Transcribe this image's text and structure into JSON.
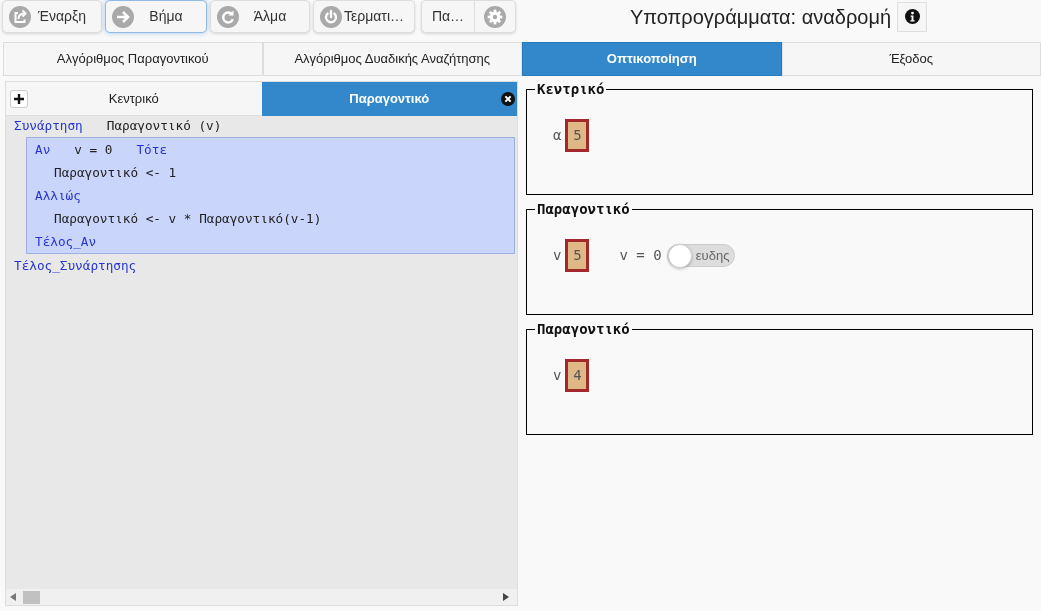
{
  "toolbar": {
    "buttons": [
      {
        "label": "Έναρξη",
        "focused": false
      },
      {
        "label": "Βήμα",
        "focused": true
      },
      {
        "label": "Άλμα",
        "focused": false
      },
      {
        "label": "Τερματι…",
        "focused": false
      }
    ],
    "menu_button": {
      "label": "Πα…"
    }
  },
  "title": "Υποπρογράμματα: αναδρομή",
  "tabs": [
    {
      "label": "Αλγόριθμος Παραγοντικού",
      "selected": false
    },
    {
      "label": "Αλγόριθμος Δυαδικής Αναζήτησης",
      "selected": false
    },
    {
      "label": "Οπτικοποίηση",
      "selected": true
    },
    {
      "label": "Έξοδος",
      "selected": false
    }
  ],
  "editor": {
    "tabs": [
      {
        "label": "Κεντρικό",
        "selected": false
      },
      {
        "label": "Παραγοντικό",
        "selected": true
      }
    ],
    "code": [
      {
        "tokens": [
          {
            "kind": "keyword",
            "text": "Συνάρτηση"
          },
          {
            "kind": "text",
            "text": "Παραγοντικό (v)"
          }
        ],
        "highlighted": false,
        "children": [
          {
            "tokens": [
              {
                "kind": "keyword",
                "text": "Αν"
              },
              {
                "kind": "text",
                "text": "v = 0"
              },
              {
                "kind": "keyword",
                "text": "Τότε"
              }
            ],
            "highlighted": true,
            "children": [
              {
                "tokens": [
                  {
                    "kind": "text",
                    "text": "Παραγοντικό <- 1"
                  }
                ],
                "highlighted": false
              }
            ]
          },
          {
            "tokens": [
              {
                "kind": "keyword",
                "text": "Αλλιώς"
              }
            ],
            "highlighted": true,
            "children": [
              {
                "tokens": [
                  {
                    "kind": "text",
                    "text": "Παραγοντικό <- v * Παραγοντικό(v-1)"
                  }
                ],
                "highlighted": false
              }
            ]
          },
          {
            "tokens": [
              {
                "kind": "keyword",
                "text": "Τέλος_Αν"
              }
            ],
            "highlighted": true
          }
        ]
      },
      {
        "tokens": [
          {
            "kind": "keyword",
            "text": "Τέλος_Συνάρτησης"
          }
        ],
        "highlighted": false
      }
    ]
  },
  "frames": [
    {
      "title": "Κεντρικό",
      "variables": [
        {
          "name": "α",
          "value": "5"
        }
      ]
    },
    {
      "title": "Παραγοντικό",
      "variables": [
        {
          "name": "v",
          "value": "5"
        }
      ],
      "conditions": [
        {
          "expression": "v = 0",
          "label": "ευδης",
          "on": false
        }
      ]
    },
    {
      "title": "Παραγοντικό",
      "variables": [
        {
          "name": "v",
          "value": "4"
        }
      ]
    }
  ]
}
